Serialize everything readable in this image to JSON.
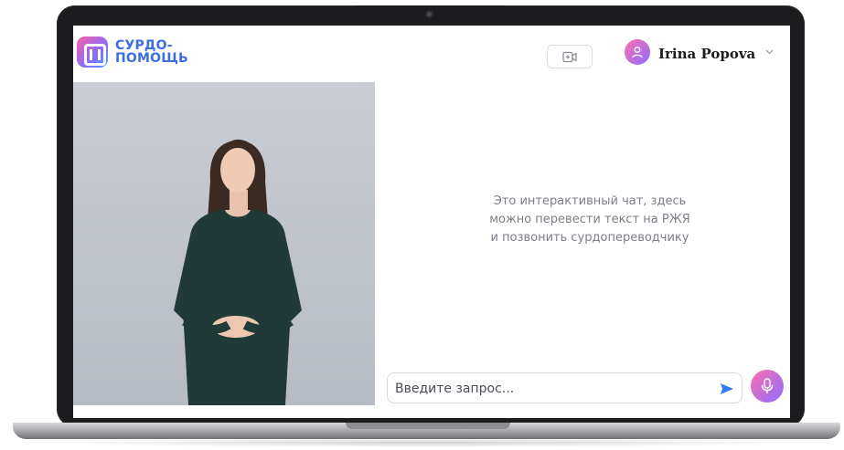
{
  "brand": {
    "line1": "СУРДО-",
    "line2": "ПОМОЩЬ"
  },
  "header": {
    "user_name": "Irina Popova"
  },
  "chat": {
    "hint_line1": "Это интерактивный чат, здесь",
    "hint_line2": "можно перевести текст на РЖЯ",
    "hint_line3": "и позвонить сурдопереводчику",
    "input_placeholder": "Введите запрос...",
    "input_value": ""
  },
  "colors": {
    "brand_blue": "#3b6fe0",
    "accent_pink": "#ff6fae",
    "accent_purple": "#8b6cff",
    "send_blue": "#2f7cf6"
  },
  "icons": {
    "logo": "logo-icon",
    "video_call": "video-camera-icon",
    "avatar": "user-icon",
    "chevron": "chevron-down-icon",
    "send": "send-icon",
    "mic": "microphone-icon"
  }
}
